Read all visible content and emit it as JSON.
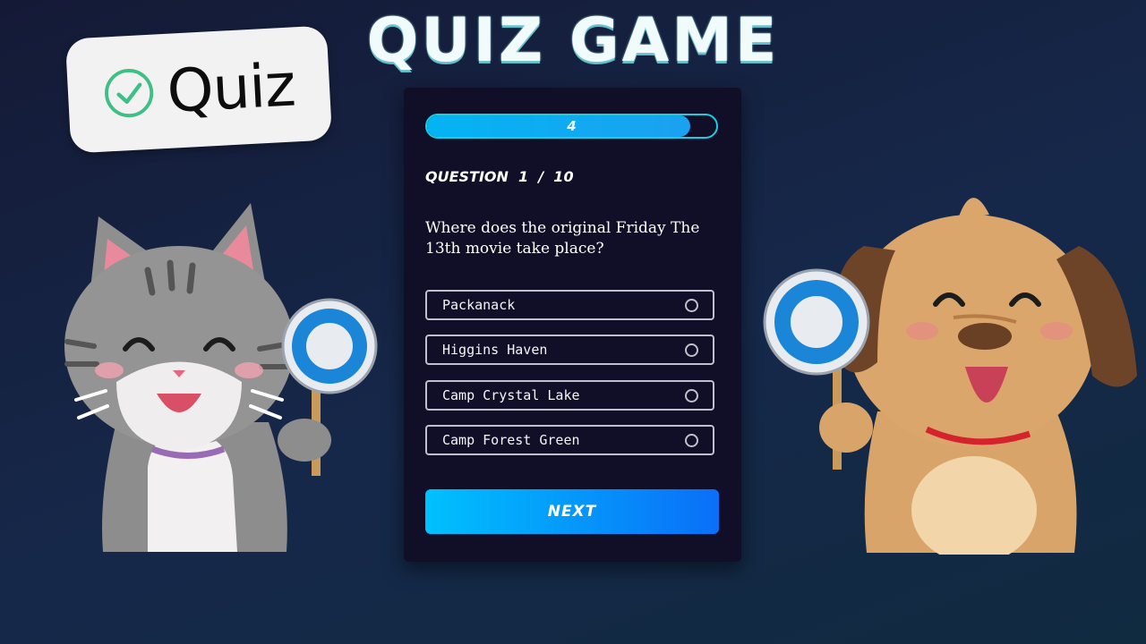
{
  "badge": {
    "text": "Quiz",
    "icon": "check-circle-icon",
    "icon_color": "#3fbf86"
  },
  "title": "QUIZ GAME",
  "progress": {
    "label": "4",
    "fraction": 0.91
  },
  "question": {
    "counter": "QUESTION  1  /  10",
    "text": "Where does the original Friday The 13th movie take place?"
  },
  "options": [
    {
      "label": "Packanack"
    },
    {
      "label": "Higgins Haven"
    },
    {
      "label": "Camp Crystal Lake"
    },
    {
      "label": "Camp Forest Green"
    }
  ],
  "next_label": "NEXT",
  "illustrations": {
    "left": "cat-holding-circle-sign",
    "right": "dog-holding-circle-sign"
  },
  "colors": {
    "accent_cyan": "#17cfe0",
    "button_start": "#00c1fd",
    "button_end": "#0a6ff8",
    "card_bg": "#100f27"
  }
}
